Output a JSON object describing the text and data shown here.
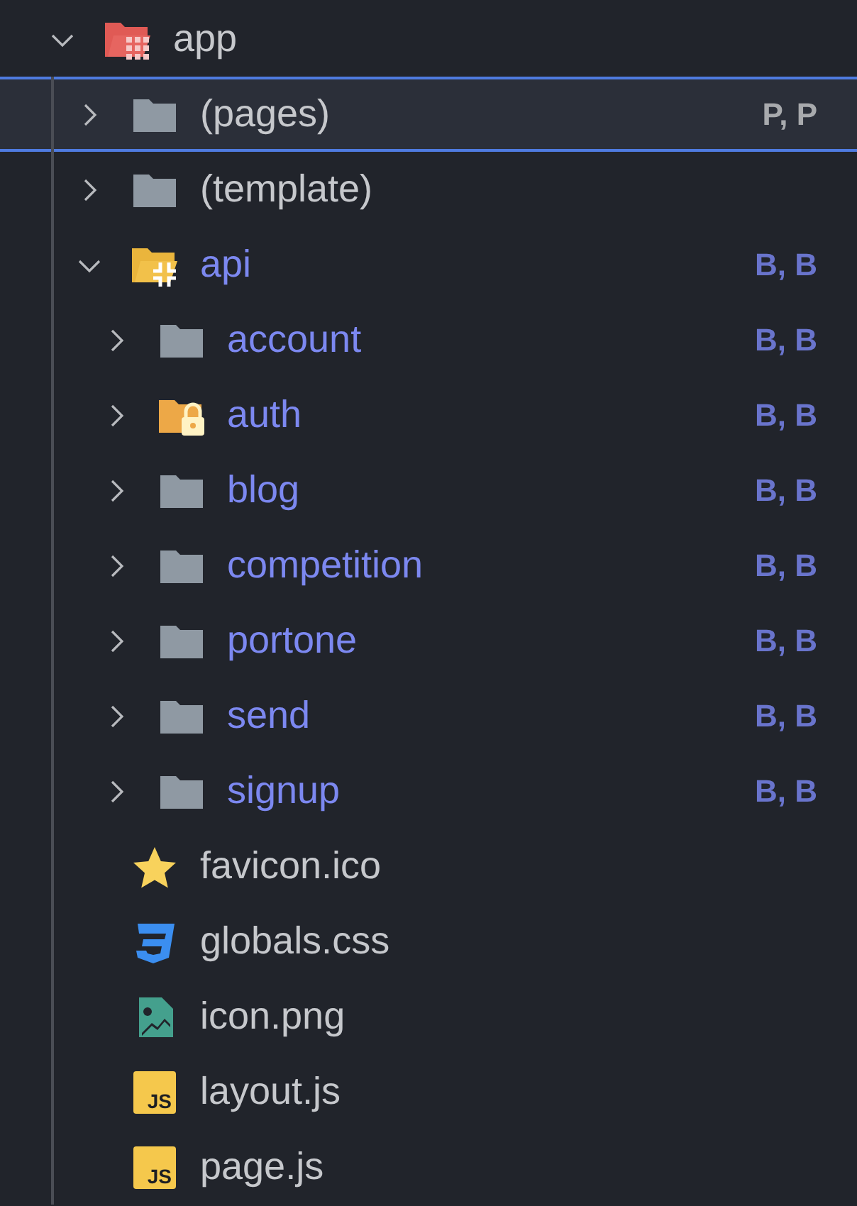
{
  "tree": [
    {
      "name": "app",
      "kind": "app-folder",
      "expanded": true,
      "selected": false,
      "color": "#c6c8cc",
      "children": [
        {
          "name": "(pages)",
          "kind": "folder",
          "expanded": false,
          "selected": true,
          "color": "#c6c8cc",
          "badge": "P, P"
        },
        {
          "name": "(template)",
          "kind": "folder",
          "expanded": false,
          "selected": false,
          "color": "#c6c8cc"
        },
        {
          "name": "api",
          "kind": "api-folder",
          "expanded": true,
          "selected": false,
          "color": "#7c88f0",
          "badge": "B, B",
          "children": [
            {
              "name": "account",
              "kind": "folder",
              "expanded": false,
              "selected": false,
              "color": "#7c88f0",
              "badge": "B, B"
            },
            {
              "name": "auth",
              "kind": "locked-folder",
              "expanded": false,
              "selected": false,
              "color": "#7c88f0",
              "badge": "B, B"
            },
            {
              "name": "blog",
              "kind": "folder",
              "expanded": false,
              "selected": false,
              "color": "#7c88f0",
              "badge": "B, B"
            },
            {
              "name": "competition",
              "kind": "folder",
              "expanded": false,
              "selected": false,
              "color": "#7c88f0",
              "badge": "B, B"
            },
            {
              "name": "portone",
              "kind": "folder",
              "expanded": false,
              "selected": false,
              "color": "#7c88f0",
              "badge": "B, B"
            },
            {
              "name": "send",
              "kind": "folder",
              "expanded": false,
              "selected": false,
              "color": "#7c88f0",
              "badge": "B, B"
            },
            {
              "name": "signup",
              "kind": "folder",
              "expanded": false,
              "selected": false,
              "color": "#7c88f0",
              "badge": "B, B"
            }
          ]
        },
        {
          "name": "favicon.ico",
          "kind": "star-file",
          "selected": false,
          "color": "#c6c8cc"
        },
        {
          "name": "globals.css",
          "kind": "css-file",
          "selected": false,
          "color": "#c6c8cc"
        },
        {
          "name": "icon.png",
          "kind": "image-file",
          "selected": false,
          "color": "#c6c8cc"
        },
        {
          "name": "layout.js",
          "kind": "js-file",
          "icon_label": "JS",
          "selected": false,
          "color": "#c6c8cc"
        },
        {
          "name": "page.js",
          "kind": "js-file",
          "icon_label": "JS",
          "selected": false,
          "color": "#c6c8cc"
        }
      ]
    }
  ]
}
